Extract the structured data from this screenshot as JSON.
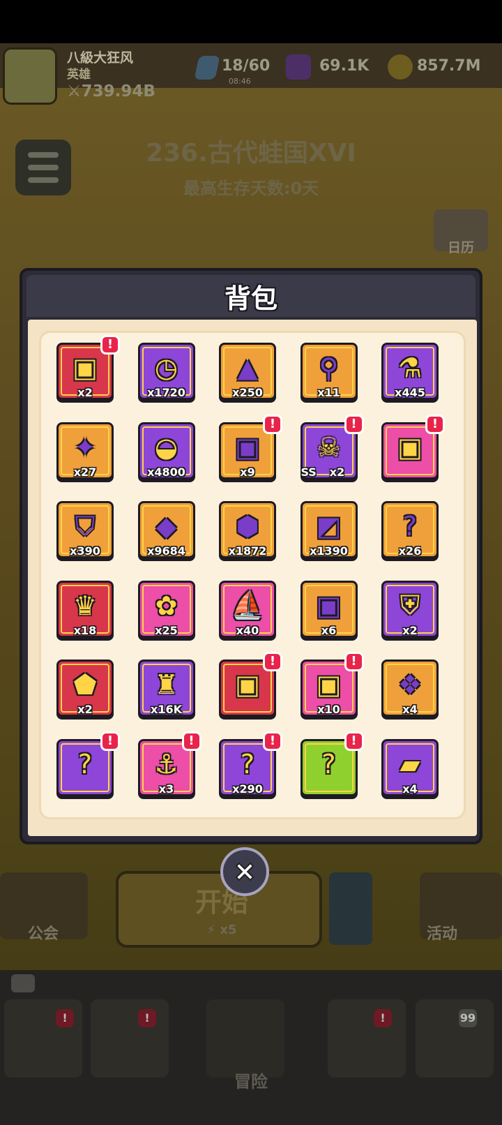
{
  "hud": {
    "player_name": "八級大狂风",
    "player_rank": "英雄",
    "power": "739.94B",
    "energy": "18/60",
    "energy_timer": "08:46",
    "gems": "69.1K",
    "coins": "857.7M"
  },
  "stage": {
    "title": "236.古代蛙国XVI",
    "subtitle": "最高生存天数:0天"
  },
  "side": {
    "calendar_label": "日历"
  },
  "dialog": {
    "title": "背包",
    "items": [
      {
        "icon": "red-golden-chest-icon",
        "count": "x2",
        "alert": true
      },
      {
        "icon": "stopwatch-icon",
        "count": "x1720",
        "alert": false
      },
      {
        "icon": "wizard-hat-icon",
        "count": "x250",
        "alert": false
      },
      {
        "icon": "magnifying-key-icon",
        "count": "x11",
        "alert": false
      },
      {
        "icon": "potion-flask-icon",
        "count": "x445",
        "alert": false
      },
      {
        "icon": "star-key-icon",
        "count": "x27",
        "alert": false
      },
      {
        "icon": "headband-icon",
        "count": "x4800",
        "alert": false
      },
      {
        "icon": "orange-golden-chest-icon",
        "count": "x9",
        "alert": true
      },
      {
        "icon": "skull-chest-icon",
        "count": "x2",
        "tier": "SS",
        "alert": true
      },
      {
        "icon": "pink-golden-chest-icon",
        "count": "",
        "alert": true
      },
      {
        "icon": "shield-badge-icon",
        "count": "x390",
        "alert": false
      },
      {
        "icon": "paw-medal-icon",
        "count": "x9684",
        "alert": false
      },
      {
        "icon": "green-crystal-icon",
        "count": "x1872",
        "alert": false
      },
      {
        "icon": "ticket-icon",
        "count": "x1390",
        "alert": false
      },
      {
        "icon": "mystery-chest-icon",
        "count": "x26",
        "alert": false
      },
      {
        "icon": "trophy-chest-icon",
        "count": "x18",
        "alert": false
      },
      {
        "icon": "dragon-pet-icon",
        "count": "x25",
        "alert": false
      },
      {
        "icon": "pirate-ship-icon",
        "count": "x40",
        "alert": false
      },
      {
        "icon": "green-gem-chest-icon",
        "count": "x6",
        "alert": false
      },
      {
        "icon": "armor-chest-icon",
        "count": "x2",
        "alert": false
      },
      {
        "icon": "purple-ore-icon",
        "count": "x2",
        "alert": false
      },
      {
        "icon": "castle-banner-icon",
        "count": "x16K",
        "alert": false
      },
      {
        "icon": "ruby-chest-icon",
        "count": "",
        "alert": true
      },
      {
        "icon": "jade-chest-icon",
        "count": "x10",
        "alert": true
      },
      {
        "icon": "cow-pet-icon",
        "count": "x4",
        "alert": false
      },
      {
        "icon": "purple-mystery-chest-icon",
        "count": "",
        "alert": true
      },
      {
        "icon": "anchor-chest-icon",
        "count": "x3",
        "alert": true
      },
      {
        "icon": "question-chest-icon",
        "count": "x290",
        "alert": true
      },
      {
        "icon": "lime-mystery-chest-icon",
        "count": "",
        "alert": true
      },
      {
        "icon": "ticket-card-icon",
        "count": "x4",
        "alert": false
      }
    ],
    "badge_symbol": "!"
  },
  "bottom": {
    "guild_label": "公会",
    "start_label": "开始",
    "start_cost": "x5",
    "event_label": "活动",
    "adventure_label": "冒险",
    "mail_count": "99"
  },
  "colors": {
    "red": "#d8364b",
    "purple": "#8e46d9",
    "orange": "#f0a03a",
    "pink": "#ec4ea8",
    "green": "#8fd02f",
    "gold": "#ffd447"
  }
}
